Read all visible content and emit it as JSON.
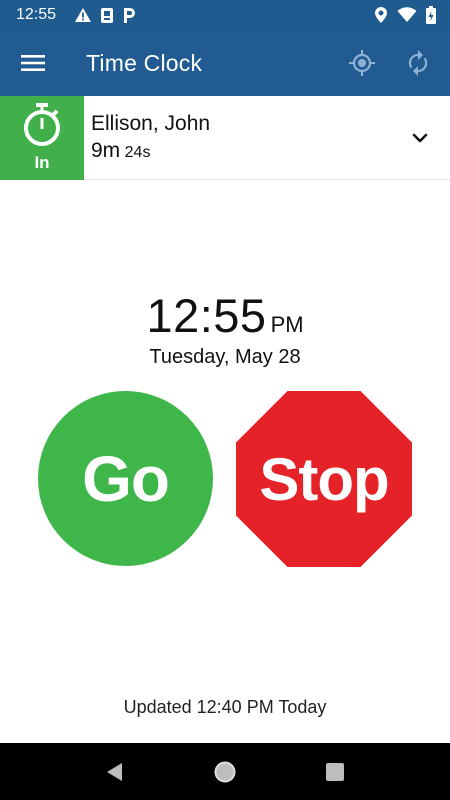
{
  "status_bar": {
    "time": "12:55",
    "left_icons": [
      "warning-icon",
      "sim-card-icon",
      "parking-icon"
    ],
    "right_icons": [
      "location-icon",
      "wifi-icon",
      "battery-icon"
    ]
  },
  "app_bar": {
    "title": "Time Clock",
    "menu_icon": "hamburger-menu-icon",
    "actions": [
      "gps-target-icon",
      "sync-icon"
    ]
  },
  "employee": {
    "status_label": "In",
    "name": "Ellison, John",
    "duration_main": "9m",
    "duration_seconds": "24s",
    "status_color": "#41b04a"
  },
  "clock": {
    "time": "12:55",
    "ampm": "PM",
    "date": "Tuesday, May 28"
  },
  "buttons": {
    "go_label": "Go",
    "stop_label": "Stop",
    "go_color": "#3eb64a",
    "stop_color": "#e62229"
  },
  "footer": {
    "updated_text": "Updated 12:40 PM Today"
  },
  "nav": [
    "back-icon",
    "home-icon",
    "recents-icon"
  ]
}
